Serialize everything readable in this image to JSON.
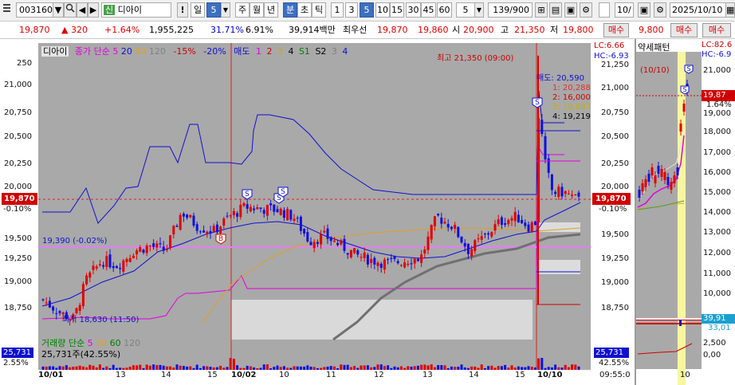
{
  "toolbar": {
    "code": "003160",
    "name_tag": "신",
    "name": "디아이",
    "period_buttons": [
      "일",
      "5",
      "주",
      "월",
      "년",
      "분",
      "초",
      "틱",
      "1",
      "3",
      "5",
      "10",
      "15",
      "30",
      "45",
      "60"
    ],
    "selected_period": "일",
    "selected_minute": "5",
    "count": "5",
    "paging": "139/900",
    "right_code": "10/",
    "date": "2025/10/10"
  },
  "quote": {
    "price": "19,870",
    "change": "▲  320",
    "change_pct": "+1.64%",
    "volume": "1,955,225",
    "vol_ratio": "31.71%",
    "turnover": "6.91%",
    "amount": "39,914백만",
    "best_label": "최우선",
    "best_sell": "19,870",
    "best_buy": "19,860",
    "open_label": "시",
    "open": "20,900",
    "high_label": "고",
    "high": "21,350",
    "low_label": "저",
    "low": "19,800",
    "buy_button": "매수",
    "side_price": "9,800",
    "side_buy": "매수",
    "side_buy2": "매수"
  },
  "main_chart": {
    "legend_name": "디아이",
    "legend_ma": "종가 단순",
    "legend_ma_periods": [
      "5",
      "20",
      "60",
      "120"
    ],
    "legend_pct": [
      "-15%",
      "-20%"
    ],
    "legend_sell": "매도",
    "legend_sell_items": [
      "1",
      "2",
      "3",
      "4",
      "S1",
      "S2",
      "3",
      "4"
    ],
    "y_ticks": [
      "21,250",
      "21,000",
      "20,750",
      "20,500",
      "20,250",
      "20,000",
      "19,750",
      "19,500",
      "19,250",
      "19,000",
      "18,750"
    ],
    "left_y_ticks": [
      "250",
      "21,000",
      "20,750",
      "20,500",
      "20,250",
      "20,000",
      "19,750",
      "19,500",
      "19,250",
      "19,000",
      "18,750"
    ],
    "current_price_label": "19,870",
    "current_pct": "-0.10%",
    "right_current_pct": "-0.10%",
    "lc_label": "LC:6.66",
    "hc_label": "HC:-6.93",
    "high_note": "최고 21,350 (09:00)",
    "low_note": "최저 18,630 (11:50)",
    "ref_line_label": "19,390 (-0.02%)",
    "sell_info": [
      "매도: 20,590",
      "1: 20,288",
      "2: 16,000",
      "3: 19,687",
      "4: 19,219"
    ],
    "x_labels": [
      "10/01",
      "13",
      "14",
      "15",
      "10/02",
      "10",
      "11",
      "12",
      "13",
      "14",
      "15",
      "10/10",
      "09:55:0"
    ],
    "signal_markers": [
      "S",
      "S",
      "S",
      "B",
      "S",
      "S",
      "S"
    ],
    "volume_legend": "거래량 단순",
    "volume_periods": [
      "5",
      "20",
      "60",
      "120"
    ],
    "volume_value": "25,731주(42.55%)",
    "volume_axis_top": "25,731",
    "volume_axis_pct": "2.55%",
    "volume_right_top": "25,731",
    "volume_right_pct": "42.55%"
  },
  "side_chart": {
    "title": "약세패턴",
    "marker_date": "(10/10)",
    "lc": "LC:82.6",
    "hc": "HC:-6.9",
    "y_ticks": [
      "21,000",
      "20,000",
      "19,000",
      "18,000",
      "17,000",
      "16,000",
      "15,000",
      "14,000",
      "13,000",
      "12,000",
      "11,000",
      "10,000"
    ],
    "price_box": "19,87",
    "pct_box": "1.64%",
    "volume_box": "39,91",
    "volume_box2": "33,01",
    "vol_ticks": [
      "2,500",
      "0,00"
    ],
    "x_label": "10"
  },
  "colors": {
    "up": "#e00000",
    "down": "#1010e0",
    "plot_bg": "#a9a9a9",
    "accent": "#3d6fc1",
    "highlight": "#f7f7a0"
  }
}
